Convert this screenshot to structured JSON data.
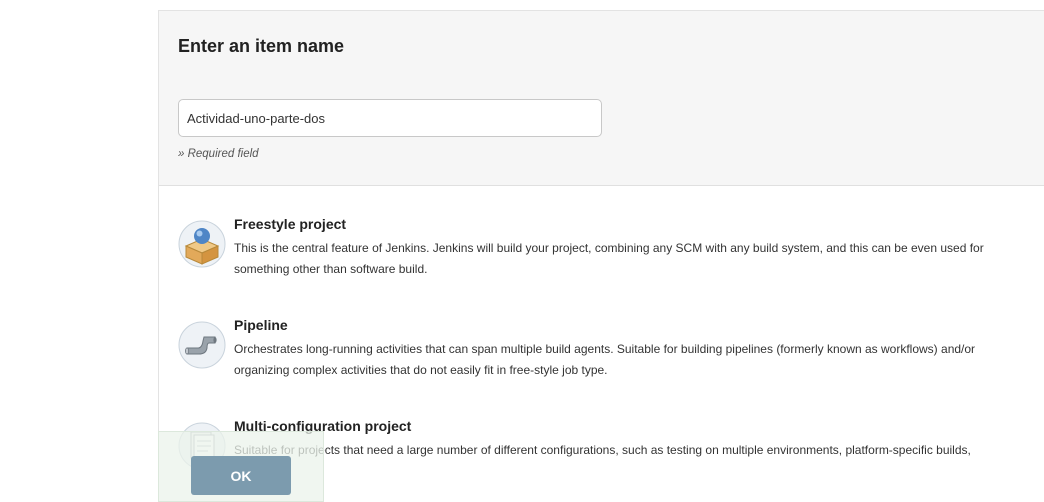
{
  "form": {
    "title": "Enter an item name",
    "name_value": "Actividad-uno-parte-dos",
    "required_note": "» Required field"
  },
  "items": [
    {
      "name": "Freestyle project",
      "description": "This is the central feature of Jenkins. Jenkins will build your project, combining any SCM with any build system, and this can be even used for something other than software build.",
      "icon": "freestyle-project-icon"
    },
    {
      "name": "Pipeline",
      "description": "Orchestrates long-running activities that can span multiple build agents. Suitable for building pipelines (formerly known as workflows) and/or organizing complex activities that do not easily fit in free-style job type.",
      "icon": "pipeline-icon"
    },
    {
      "name": "Multi-configuration project",
      "description": "Suitable for projects that need a large number of different configurations, such as testing on multiple environments, platform-specific builds,",
      "icon": "multi-configuration-icon"
    }
  ],
  "actions": {
    "ok_label": "OK"
  },
  "colors": {
    "ok_button": "#7c9bae",
    "header_bg": "#f6f6f6"
  }
}
